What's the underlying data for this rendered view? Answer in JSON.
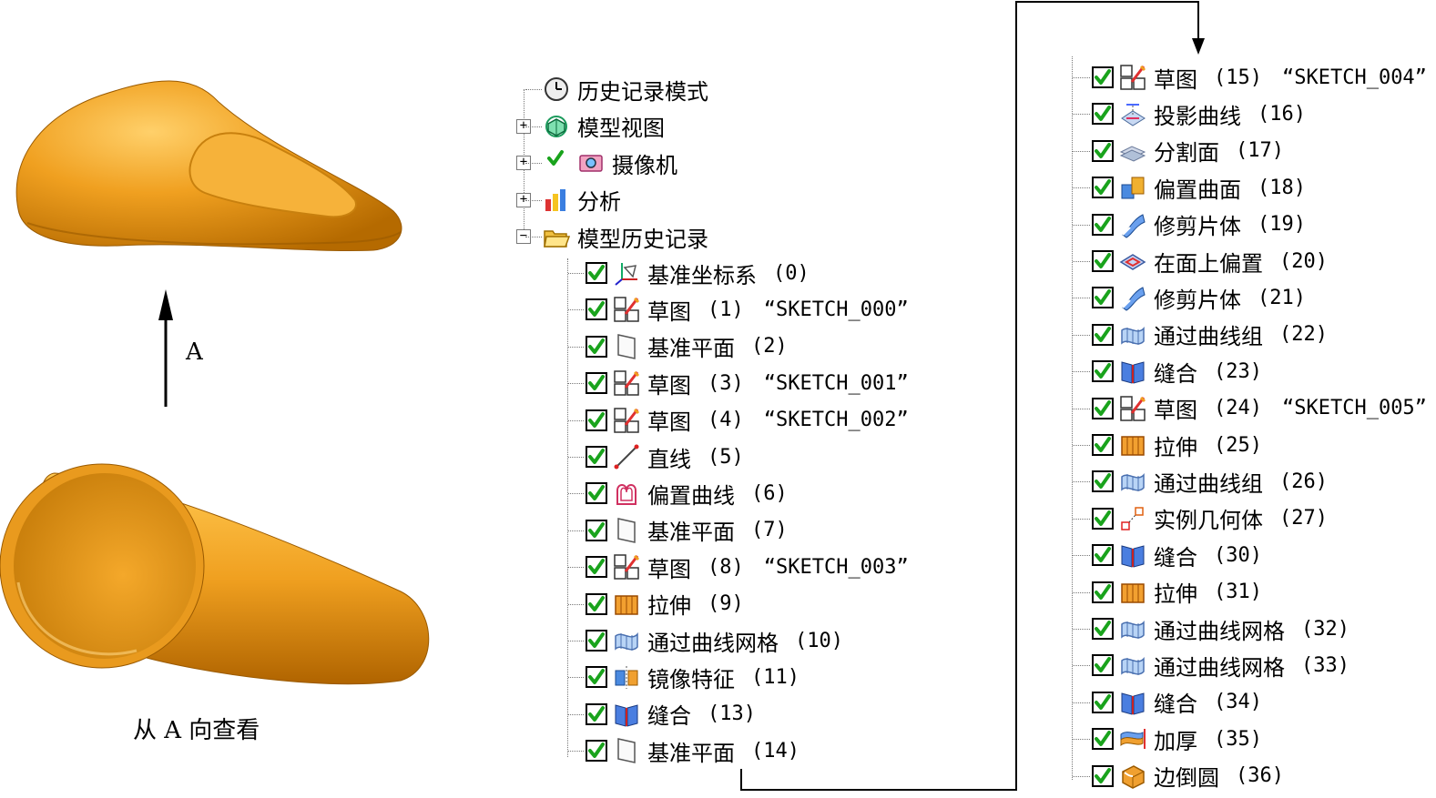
{
  "figure": {
    "arrow_label": "A",
    "view_caption": "从 A 向查看"
  },
  "tree_top": [
    {
      "label": "历史记录模式",
      "icon": "clock-icon",
      "expander": ""
    },
    {
      "label": "模型视图",
      "icon": "model-views-icon",
      "expander": "+"
    },
    {
      "label": "摄像机",
      "icon": "camera-icon",
      "expander": "+"
    },
    {
      "label": "分析",
      "icon": "analysis-icon",
      "expander": "+"
    },
    {
      "label": "模型历史记录",
      "icon": "open-folder-icon",
      "expander": "−"
    }
  ],
  "history_left": [
    {
      "label": "基准坐标系",
      "num": "(0)",
      "sketch": "",
      "icon": "datum-csys-icon"
    },
    {
      "label": "草图",
      "num": "(1)",
      "sketch": "“SKETCH_000”",
      "icon": "sketch-icon"
    },
    {
      "label": "基准平面",
      "num": "(2)",
      "sketch": "",
      "icon": "datum-plane-icon"
    },
    {
      "label": "草图",
      "num": "(3)",
      "sketch": "“SKETCH_001”",
      "icon": "sketch-icon"
    },
    {
      "label": "草图",
      "num": "(4)",
      "sketch": "“SKETCH_002”",
      "icon": "sketch-icon"
    },
    {
      "label": "直线",
      "num": "(5)",
      "sketch": "",
      "icon": "line-icon"
    },
    {
      "label": "偏置曲线",
      "num": "(6)",
      "sketch": "",
      "icon": "offset-curve-icon"
    },
    {
      "label": "基准平面",
      "num": "(7)",
      "sketch": "",
      "icon": "datum-plane-icon"
    },
    {
      "label": "草图",
      "num": "(8)",
      "sketch": "“SKETCH_003”",
      "icon": "sketch-icon"
    },
    {
      "label": "拉伸",
      "num": "(9)",
      "sketch": "",
      "icon": "extrude-icon"
    },
    {
      "label": "通过曲线网格",
      "num": "(10)",
      "sketch": "",
      "icon": "curve-mesh-icon"
    },
    {
      "label": "镜像特征",
      "num": "(11)",
      "sketch": "",
      "icon": "mirror-feature-icon"
    },
    {
      "label": "缝合",
      "num": "(13)",
      "sketch": "",
      "icon": "sew-icon"
    },
    {
      "label": "基准平面",
      "num": "(14)",
      "sketch": "",
      "icon": "datum-plane-icon"
    }
  ],
  "history_right": [
    {
      "label": "草图",
      "num": "(15)",
      "sketch": "“SKETCH_004”",
      "icon": "sketch-icon"
    },
    {
      "label": "投影曲线",
      "num": "(16)",
      "sketch": "",
      "icon": "project-curve-icon"
    },
    {
      "label": "分割面",
      "num": "(17)",
      "sketch": "",
      "icon": "divide-face-icon"
    },
    {
      "label": "偏置曲面",
      "num": "(18)",
      "sketch": "",
      "icon": "offset-surface-icon"
    },
    {
      "label": "修剪片体",
      "num": "(19)",
      "sketch": "",
      "icon": "trim-sheet-icon"
    },
    {
      "label": "在面上偏置",
      "num": "(20)",
      "sketch": "",
      "icon": "offset-in-face-icon"
    },
    {
      "label": "修剪片体",
      "num": "(21)",
      "sketch": "",
      "icon": "trim-sheet-icon"
    },
    {
      "label": "通过曲线组",
      "num": "(22)",
      "sketch": "",
      "icon": "through-curves-icon"
    },
    {
      "label": "缝合",
      "num": "(23)",
      "sketch": "",
      "icon": "sew-icon"
    },
    {
      "label": "草图",
      "num": "(24)",
      "sketch": "“SKETCH_005”",
      "icon": "sketch-icon"
    },
    {
      "label": "拉伸",
      "num": "(25)",
      "sketch": "",
      "icon": "extrude-icon"
    },
    {
      "label": "通过曲线组",
      "num": "(26)",
      "sketch": "",
      "icon": "through-curves-icon"
    },
    {
      "label": "实例几何体",
      "num": "(27)",
      "sketch": "",
      "icon": "instance-geometry-icon"
    },
    {
      "label": "缝合",
      "num": "(30)",
      "sketch": "",
      "icon": "sew-icon"
    },
    {
      "label": "拉伸",
      "num": "(31)",
      "sketch": "",
      "icon": "extrude-icon"
    },
    {
      "label": "通过曲线网格",
      "num": "(32)",
      "sketch": "",
      "icon": "curve-mesh-icon"
    },
    {
      "label": "通过曲线网格",
      "num": "(33)",
      "sketch": "",
      "icon": "curve-mesh-icon"
    },
    {
      "label": "缝合",
      "num": "(34)",
      "sketch": "",
      "icon": "sew-icon"
    },
    {
      "label": "加厚",
      "num": "(35)",
      "sketch": "",
      "icon": "thicken-icon"
    },
    {
      "label": "边倒圆",
      "num": "(36)",
      "sketch": "",
      "icon": "edge-blend-icon"
    }
  ],
  "colors": {
    "part_orange": "#f0a020",
    "check_green": "#19a31c",
    "tree_line": "#777777"
  }
}
